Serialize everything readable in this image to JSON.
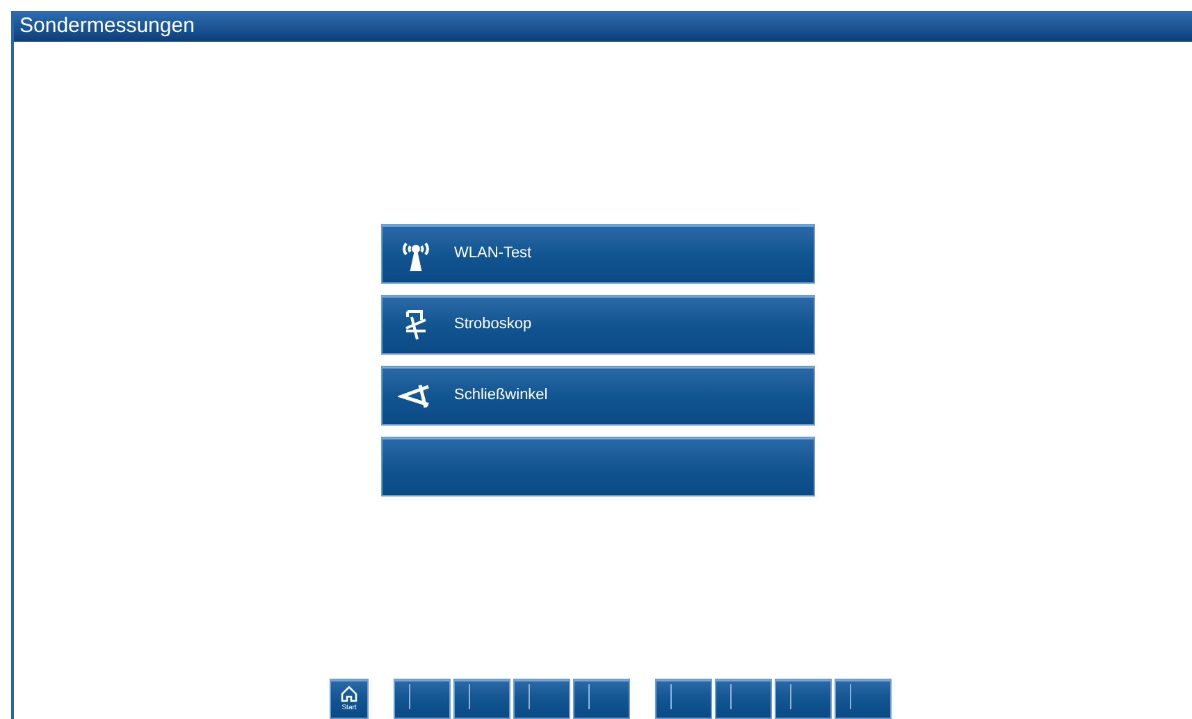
{
  "window": {
    "title": "Sondermessungen"
  },
  "menu": [
    {
      "kind": "wlan",
      "label": "WLAN-Test"
    },
    {
      "kind": "strobe",
      "label": "Stroboskop"
    },
    {
      "kind": "angle",
      "label": "Schließwinkel"
    },
    {
      "kind": "blank"
    }
  ],
  "home_button": {
    "label": "Start"
  },
  "function_key_groups": [
    [
      {
        "kind": "blank"
      },
      {
        "kind": "blank"
      },
      {
        "kind": "blank"
      },
      {
        "kind": "blank"
      }
    ],
    [
      {
        "kind": "blank"
      },
      {
        "kind": "blank"
      },
      {
        "kind": "blank"
      },
      {
        "kind": "blank"
      }
    ]
  ]
}
